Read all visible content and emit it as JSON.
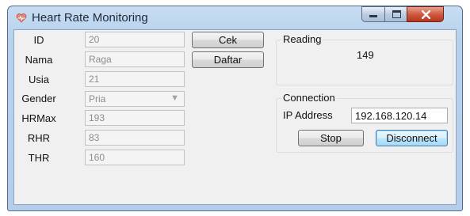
{
  "window": {
    "title": "Heart Rate Monitoring",
    "icon": "heart-icon",
    "accent_color": "#b9d2ec",
    "close_color": "#cf5a42"
  },
  "caption_buttons": {
    "minimize": "minimize-icon",
    "maximize": "maximize-icon",
    "close": "close-icon"
  },
  "form": {
    "fields": [
      {
        "label": "ID",
        "value": "20"
      },
      {
        "label": "Nama",
        "value": "Raga"
      },
      {
        "label": "Usia",
        "value": "21"
      },
      {
        "label": "Gender",
        "value": "Pria"
      },
      {
        "label": "HRMax",
        "value": "193"
      },
      {
        "label": "RHR",
        "value": "83"
      },
      {
        "label": "THR",
        "value": "160"
      }
    ],
    "cek_label": "Cek",
    "daftar_label": "Daftar"
  },
  "reading": {
    "title": "Reading",
    "value": "149"
  },
  "connection": {
    "title": "Connection",
    "ip_label": "IP Address",
    "ip_value": "192.168.120.14",
    "stop_label": "Stop",
    "disconnect_label": "Disconnect"
  }
}
